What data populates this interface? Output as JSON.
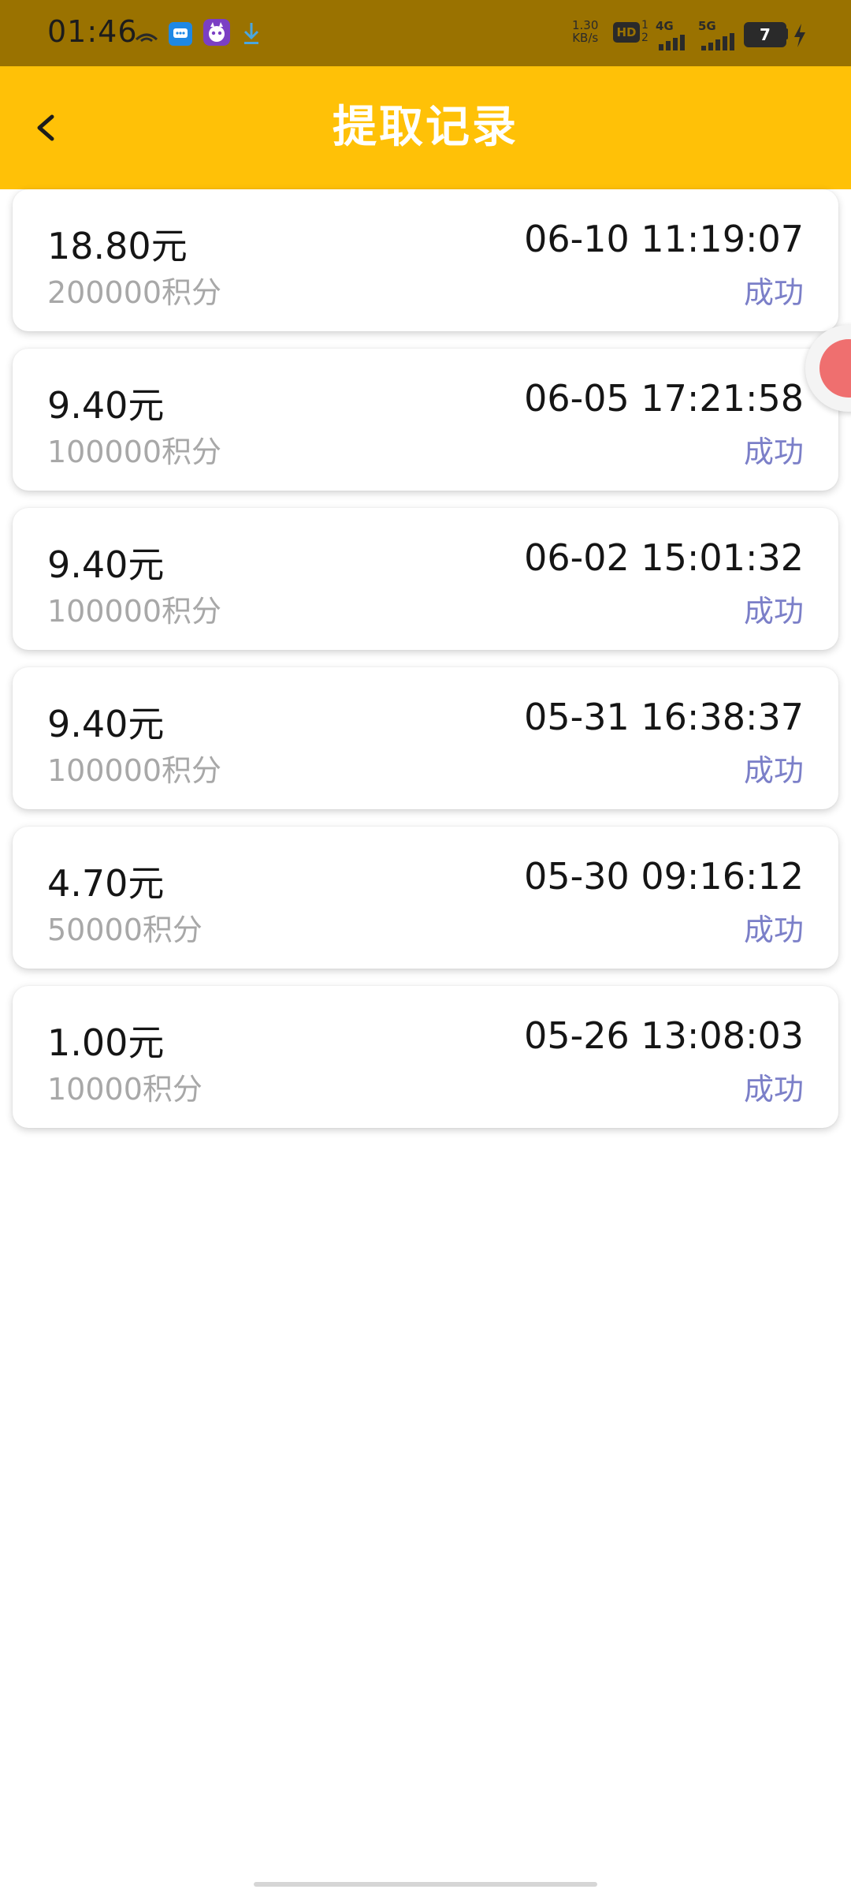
{
  "status_bar": {
    "time": "01:46",
    "net_speed_value": "1.30",
    "net_speed_unit": "KB/s",
    "hd_label": "HD",
    "hd_sub": "1\n2",
    "net_4g": "4G",
    "net_5g": "5G",
    "battery_level": "7",
    "icons": [
      "link-icon",
      "message-app-icon",
      "cat-app-icon",
      "download-icon",
      "signal-icon",
      "battery-icon",
      "charging-icon"
    ]
  },
  "header": {
    "title": "提取记录",
    "back_icon": "chevron-left-icon",
    "background_color": "#ffc107"
  },
  "records": [
    {
      "amount": "18.80元",
      "points": "200000积分",
      "time": "06-10 11:19:07",
      "status": "成功"
    },
    {
      "amount": "9.40元",
      "points": "100000积分",
      "time": "06-05 17:21:58",
      "status": "成功"
    },
    {
      "amount": "9.40元",
      "points": "100000积分",
      "time": "06-02 15:01:32",
      "status": "成功"
    },
    {
      "amount": "9.40元",
      "points": "100000积分",
      "time": "05-31 16:38:37",
      "status": "成功"
    },
    {
      "amount": "4.70元",
      "points": "50000积分",
      "time": "05-30 09:16:12",
      "status": "成功"
    },
    {
      "amount": "1.00元",
      "points": "10000积分",
      "time": "05-26 13:08:03",
      "status": "成功"
    }
  ],
  "colors": {
    "status_success": "#7b7fc8",
    "points_text": "#a8a8a8"
  }
}
